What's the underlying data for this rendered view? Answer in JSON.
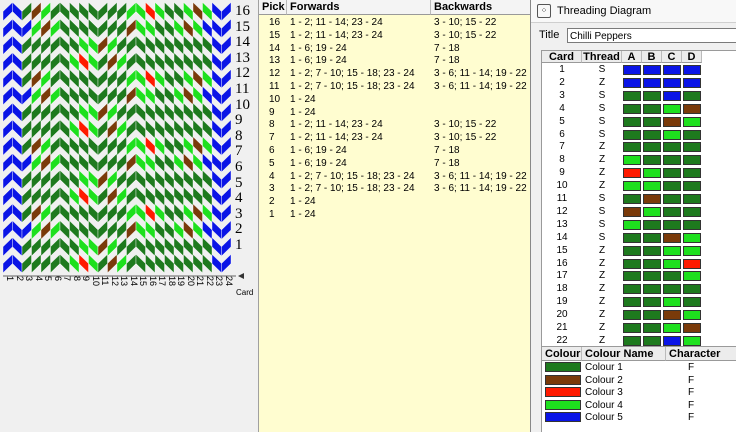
{
  "pattern": {
    "pick_numbers": [
      "16",
      "15",
      "14",
      "13",
      "12",
      "11",
      "10",
      "9",
      "8",
      "7",
      "6",
      "5",
      "4",
      "3",
      "2",
      "1"
    ],
    "card_numbers": [
      "1",
      "2",
      "3",
      "4",
      "5",
      "6",
      "7",
      "8",
      "9",
      "10",
      "11",
      "12",
      "13",
      "14",
      "15",
      "16",
      "17",
      "18",
      "19",
      "20",
      "21",
      "22",
      "23",
      "24"
    ],
    "card_axis_label": "Card"
  },
  "pick_list": {
    "headers": {
      "pick": "Pick",
      "forwards": "Forwards",
      "backwards": "Backwards"
    },
    "rows": [
      {
        "pick": "16",
        "forwards": "1 - 2; 11 - 14; 23 - 24",
        "backwards": "3 - 10; 15 - 22"
      },
      {
        "pick": "15",
        "forwards": "1 - 2; 11 - 14; 23 - 24",
        "backwards": "3 - 10; 15 - 22"
      },
      {
        "pick": "14",
        "forwards": "1 - 6; 19 - 24",
        "backwards": "7 - 18"
      },
      {
        "pick": "13",
        "forwards": "1 - 6; 19 - 24",
        "backwards": "7 - 18"
      },
      {
        "pick": "12",
        "forwards": "1 - 2; 7 - 10; 15 - 18; 23 - 24",
        "backwards": "3 - 6; 11 - 14; 19 - 22"
      },
      {
        "pick": "11",
        "forwards": "1 - 2; 7 - 10; 15 - 18; 23 - 24",
        "backwards": "3 - 6; 11 - 14; 19 - 22"
      },
      {
        "pick": "10",
        "forwards": "1 - 24",
        "backwards": ""
      },
      {
        "pick": "9",
        "forwards": "1 - 24",
        "backwards": ""
      },
      {
        "pick": "8",
        "forwards": "1 - 2; 11 - 14; 23 - 24",
        "backwards": "3 - 10; 15 - 22"
      },
      {
        "pick": "7",
        "forwards": "1 - 2; 11 - 14; 23 - 24",
        "backwards": "3 - 10; 15 - 22"
      },
      {
        "pick": "6",
        "forwards": "1 - 6; 19 - 24",
        "backwards": "7 - 18"
      },
      {
        "pick": "5",
        "forwards": "1 - 6; 19 - 24",
        "backwards": "7 - 18"
      },
      {
        "pick": "4",
        "forwards": "1 - 2; 7 - 10; 15 - 18; 23 - 24",
        "backwards": "3 - 6; 11 - 14; 19 - 22"
      },
      {
        "pick": "3",
        "forwards": "1 - 2; 7 - 10; 15 - 18; 23 - 24",
        "backwards": "3 - 6; 11 - 14; 19 - 22"
      },
      {
        "pick": "2",
        "forwards": "1 - 24",
        "backwards": ""
      },
      {
        "pick": "1",
        "forwards": "1 - 24",
        "backwards": ""
      }
    ]
  },
  "threading": {
    "window_title": "Threading Diagram",
    "title_label": "Title",
    "title_value": "Chilli Peppers",
    "headers": {
      "card": "Card",
      "thread": "Thread",
      "a": "A",
      "b": "B",
      "c": "C",
      "d": "D"
    },
    "cards": [
      {
        "card": "1",
        "thread": "S",
        "holes": [
          "blue",
          "blue",
          "blue",
          "blue"
        ]
      },
      {
        "card": "2",
        "thread": "Z",
        "holes": [
          "blue",
          "blue",
          "blue",
          "blue"
        ]
      },
      {
        "card": "3",
        "thread": "S",
        "holes": [
          "dkgreen",
          "dkgreen",
          "blue",
          "dkgreen"
        ]
      },
      {
        "card": "4",
        "thread": "S",
        "holes": [
          "dkgreen",
          "dkgreen",
          "ltgreen",
          "brown"
        ]
      },
      {
        "card": "5",
        "thread": "S",
        "holes": [
          "dkgreen",
          "dkgreen",
          "brown",
          "ltgreen"
        ]
      },
      {
        "card": "6",
        "thread": "S",
        "holes": [
          "dkgreen",
          "dkgreen",
          "ltgreen",
          "dkgreen"
        ]
      },
      {
        "card": "7",
        "thread": "Z",
        "holes": [
          "dkgreen",
          "dkgreen",
          "dkgreen",
          "dkgreen"
        ]
      },
      {
        "card": "8",
        "thread": "Z",
        "holes": [
          "ltgreen",
          "dkgreen",
          "dkgreen",
          "dkgreen"
        ]
      },
      {
        "card": "9",
        "thread": "Z",
        "holes": [
          "red",
          "ltgreen",
          "dkgreen",
          "dkgreen"
        ]
      },
      {
        "card": "10",
        "thread": "Z",
        "holes": [
          "ltgreen",
          "ltgreen",
          "dkgreen",
          "dkgreen"
        ]
      },
      {
        "card": "11",
        "thread": "S",
        "holes": [
          "dkgreen",
          "brown",
          "dkgreen",
          "dkgreen"
        ]
      },
      {
        "card": "12",
        "thread": "S",
        "holes": [
          "brown",
          "ltgreen",
          "dkgreen",
          "dkgreen"
        ]
      },
      {
        "card": "13",
        "thread": "S",
        "holes": [
          "ltgreen",
          "dkgreen",
          "dkgreen",
          "dkgreen"
        ]
      },
      {
        "card": "14",
        "thread": "S",
        "holes": [
          "dkgreen",
          "dkgreen",
          "brown",
          "ltgreen"
        ]
      },
      {
        "card": "15",
        "thread": "Z",
        "holes": [
          "dkgreen",
          "dkgreen",
          "ltgreen",
          "ltgreen"
        ]
      },
      {
        "card": "16",
        "thread": "Z",
        "holes": [
          "dkgreen",
          "dkgreen",
          "ltgreen",
          "red"
        ]
      },
      {
        "card": "17",
        "thread": "Z",
        "holes": [
          "dkgreen",
          "dkgreen",
          "dkgreen",
          "ltgreen"
        ]
      },
      {
        "card": "18",
        "thread": "Z",
        "holes": [
          "dkgreen",
          "dkgreen",
          "dkgreen",
          "dkgreen"
        ]
      },
      {
        "card": "19",
        "thread": "Z",
        "holes": [
          "dkgreen",
          "dkgreen",
          "ltgreen",
          "dkgreen"
        ]
      },
      {
        "card": "20",
        "thread": "Z",
        "holes": [
          "dkgreen",
          "dkgreen",
          "brown",
          "ltgreen"
        ]
      },
      {
        "card": "21",
        "thread": "Z",
        "holes": [
          "dkgreen",
          "dkgreen",
          "ltgreen",
          "brown"
        ]
      },
      {
        "card": "22",
        "thread": "Z",
        "holes": [
          "dkgreen",
          "dkgreen",
          "blue",
          "ltgreen"
        ]
      }
    ]
  },
  "colours": {
    "headers": {
      "colour": "Colour",
      "name": "Colour Name",
      "character": "Character"
    },
    "rows": [
      {
        "key": "dkgreen",
        "hex": "#1e7a1e",
        "name": "Colour 1",
        "character": "F"
      },
      {
        "key": "brown",
        "hex": "#7a3a0a",
        "name": "Colour 2",
        "character": "F"
      },
      {
        "key": "red",
        "hex": "#ff1a00",
        "name": "Colour 3",
        "character": "F"
      },
      {
        "key": "ltgreen",
        "hex": "#1ee01e",
        "name": "Colour 4",
        "character": "F"
      },
      {
        "key": "blue",
        "hex": "#0a14e6",
        "name": "Colour 5",
        "character": "F"
      }
    ]
  }
}
